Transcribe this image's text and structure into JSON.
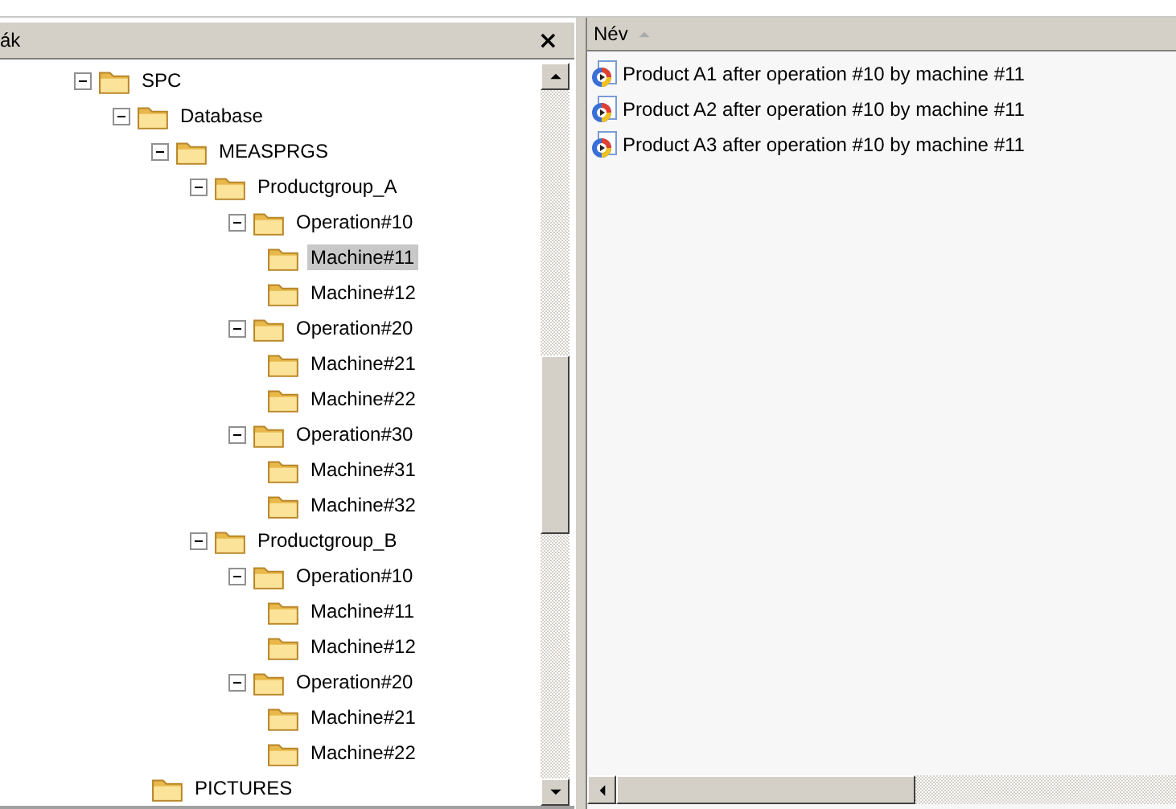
{
  "left_pane": {
    "title": "ák",
    "close": "×"
  },
  "tree": [
    {
      "label": "SPC",
      "expanded": true,
      "selected": false,
      "children": [
        {
          "label": "Database",
          "expanded": true,
          "selected": false,
          "children": [
            {
              "label": "MEASPRGS",
              "expanded": true,
              "selected": false,
              "children": [
                {
                  "label": "Productgroup_A",
                  "expanded": true,
                  "selected": false,
                  "children": [
                    {
                      "label": "Operation#10",
                      "expanded": true,
                      "selected": false,
                      "children": [
                        {
                          "label": "Machine#11",
                          "selected": true
                        },
                        {
                          "label": "Machine#12",
                          "selected": false
                        }
                      ]
                    },
                    {
                      "label": "Operation#20",
                      "expanded": true,
                      "selected": false,
                      "children": [
                        {
                          "label": "Machine#21",
                          "selected": false
                        },
                        {
                          "label": "Machine#22",
                          "selected": false
                        }
                      ]
                    },
                    {
                      "label": "Operation#30",
                      "expanded": true,
                      "selected": false,
                      "children": [
                        {
                          "label": "Machine#31",
                          "selected": false
                        },
                        {
                          "label": "Machine#32",
                          "selected": false
                        }
                      ]
                    }
                  ]
                },
                {
                  "label": "Productgroup_B",
                  "expanded": true,
                  "selected": false,
                  "children": [
                    {
                      "label": "Operation#10",
                      "expanded": true,
                      "selected": false,
                      "children": [
                        {
                          "label": "Machine#11",
                          "selected": false
                        },
                        {
                          "label": "Machine#12",
                          "selected": false
                        }
                      ]
                    },
                    {
                      "label": "Operation#20",
                      "expanded": true,
                      "selected": false,
                      "children": [
                        {
                          "label": "Machine#21",
                          "selected": false
                        },
                        {
                          "label": "Machine#22",
                          "selected": false
                        }
                      ]
                    }
                  ]
                }
              ]
            },
            {
              "label": "PICTURES",
              "selected": false
            }
          ]
        }
      ]
    }
  ],
  "list": {
    "columns": [
      {
        "label": "Név",
        "sorted": true
      }
    ],
    "rows": [
      {
        "name": "Product A1 after operation #10 by machine #11"
      },
      {
        "name": "Product A2 after operation #10 by machine #11"
      },
      {
        "name": "Product A3 after operation #10 by machine #11"
      }
    ]
  }
}
